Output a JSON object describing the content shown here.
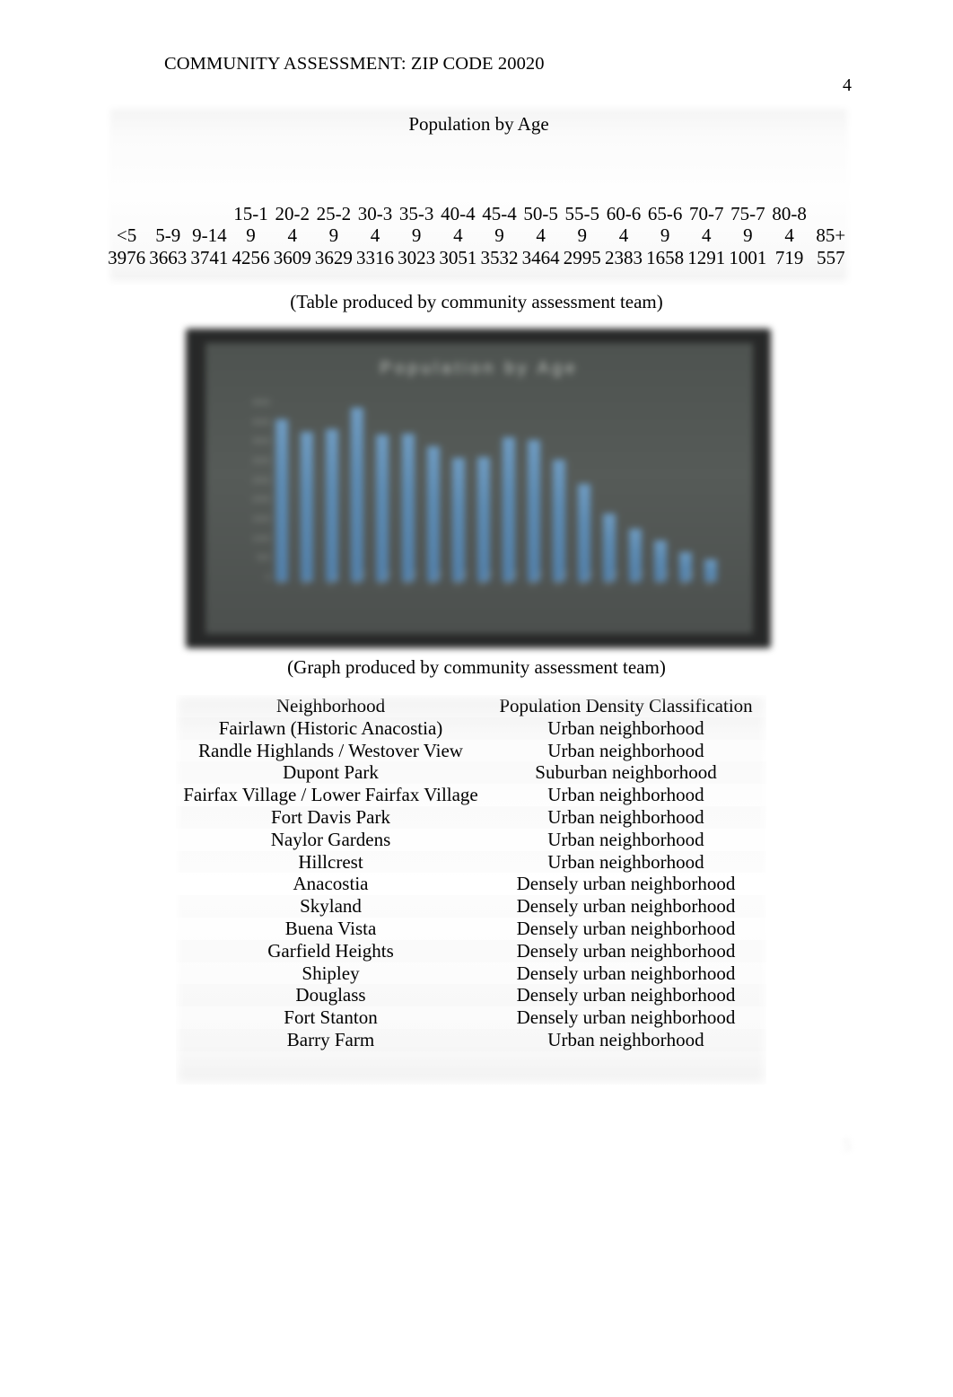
{
  "document": {
    "running_head": "COMMUNITY ASSESSMENT: ZIP CODE 20020",
    "page_number": "4",
    "page_number_bottom": "5"
  },
  "age_table": {
    "title": "Population by Age",
    "caption": "(Table produced by community assessment team)",
    "columns": [
      "<5",
      "5-9",
      "9-14",
      "15-19",
      "20-24",
      "25-29",
      "30-34",
      "35-39",
      "40-44",
      "45-49",
      "50-54",
      "55-59",
      "60-64",
      "65-69",
      "70-74",
      "75-79",
      "80-84",
      "85+"
    ],
    "values": [
      "3976",
      "3663",
      "3741",
      "4256",
      "3609",
      "3629",
      "3316",
      "3023",
      "3051",
      "3532",
      "3464",
      "2995",
      "2383",
      "1658",
      "1291",
      "1001",
      "719",
      "557"
    ]
  },
  "chart_data": {
    "type": "bar",
    "title": "Population by Age",
    "xlabel": "",
    "ylabel": "",
    "categories": [
      "<5",
      "5-9",
      "9-14",
      "15-19",
      "20-24",
      "25-29",
      "30-34",
      "35-39",
      "40-44",
      "45-49",
      "50-54",
      "55-59",
      "60-64",
      "65-69",
      "70-74",
      "75-79",
      "80-84",
      "85+"
    ],
    "values": [
      3976,
      3663,
      3741,
      4256,
      3609,
      3629,
      3316,
      3023,
      3051,
      3532,
      3464,
      2995,
      2383,
      1658,
      1291,
      1001,
      719,
      557
    ],
    "ylim": [
      0,
      4500
    ],
    "ytick_labels": [
      "4500",
      "4000",
      "3500",
      "3000",
      "2500",
      "2000",
      "1500",
      "1000",
      "500",
      "0"
    ],
    "grid": false,
    "legend": "none",
    "bar_color": "#5d8cb4",
    "plot_background": "#555a58",
    "frame_background": "#272828",
    "caption": "(Graph produced by community assessment team)"
  },
  "neighborhood_table": {
    "headers": [
      "Neighborhood",
      "Population Density Classification"
    ],
    "rows": [
      {
        "neighborhood": "Fairlawn (Historic Anacostia)",
        "classification": "Urban neighborhood"
      },
      {
        "neighborhood": "Randle Highlands / Westover View",
        "classification": "Urban neighborhood"
      },
      {
        "neighborhood": "Dupont Park",
        "classification": "Suburban neighborhood"
      },
      {
        "neighborhood": "Fairfax Village / Lower Fairfax Village",
        "classification": "Urban neighborhood"
      },
      {
        "neighborhood": "Fort Davis Park",
        "classification": "Urban neighborhood"
      },
      {
        "neighborhood": "Naylor Gardens",
        "classification": "Urban neighborhood"
      },
      {
        "neighborhood": "Hillcrest",
        "classification": "Urban neighborhood"
      },
      {
        "neighborhood": "Anacostia",
        "classification": "Densely urban neighborhood"
      },
      {
        "neighborhood": "Skyland",
        "classification": "Densely urban neighborhood"
      },
      {
        "neighborhood": "Buena Vista",
        "classification": "Densely urban neighborhood"
      },
      {
        "neighborhood": "Garfield Heights",
        "classification": "Densely urban neighborhood"
      },
      {
        "neighborhood": "Shipley",
        "classification": "Densely urban neighborhood"
      },
      {
        "neighborhood": "Douglass",
        "classification": "Densely urban neighborhood"
      },
      {
        "neighborhood": "Fort Stanton",
        "classification": "Densely urban neighborhood"
      },
      {
        "neighborhood": "Barry Farm",
        "classification": "Urban neighborhood"
      }
    ]
  },
  "source_note": {
    "line1": "",
    "line2": ""
  }
}
